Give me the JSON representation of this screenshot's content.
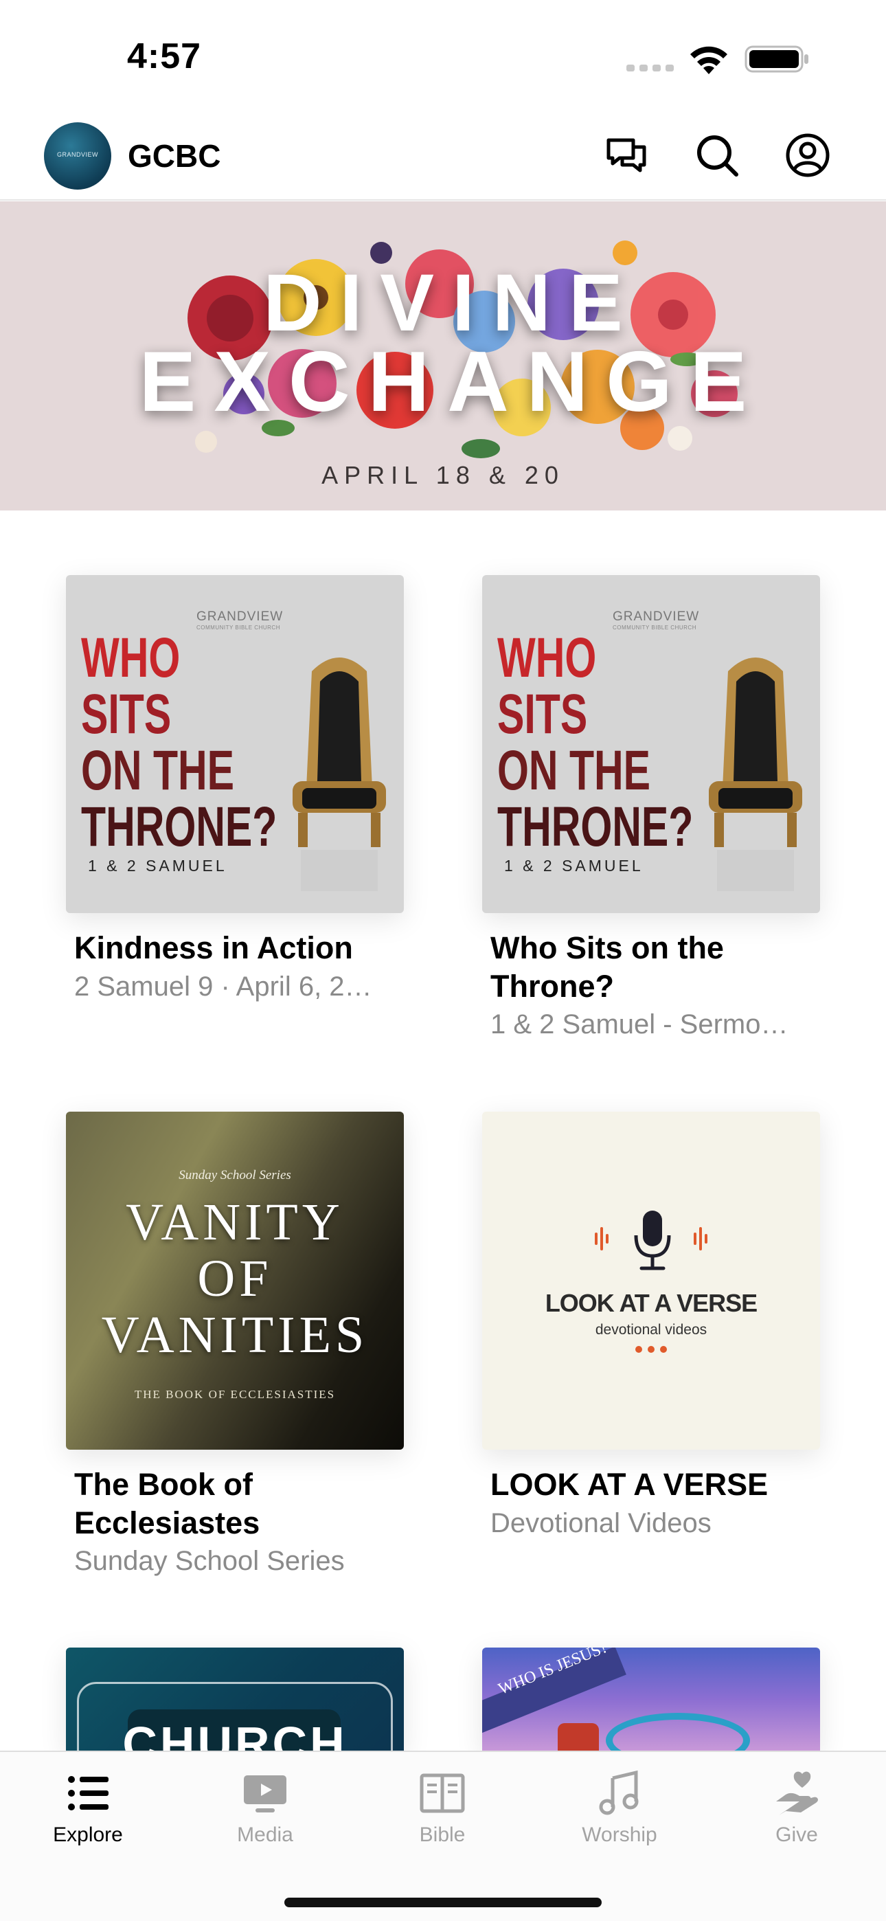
{
  "status_bar": {
    "time": "4:57"
  },
  "header": {
    "title": "GCBC",
    "avatar_text": "GRANDVIEW"
  },
  "banner": {
    "line1": "DIVINE",
    "line2": "EXCHANGE",
    "date": "APRIL 18 & 20"
  },
  "cards": [
    {
      "title": "Kindness in Action",
      "subtitle": "2 Samuel 9 · April 6, 2…",
      "art": {
        "brand": "GRANDVIEW",
        "brand_small": "COMMUNITY BIBLE CHURCH",
        "words": [
          "WHO",
          "SITS",
          "ON THE",
          "THRONE?"
        ],
        "series": "1 & 2 SAMUEL"
      }
    },
    {
      "title": "Who Sits on the Throne?",
      "subtitle": "1 & 2 Samuel - Sermo…",
      "art": {
        "brand": "GRANDVIEW",
        "brand_small": "COMMUNITY BIBLE CHURCH",
        "words": [
          "WHO",
          "SITS",
          "ON THE",
          "THRONE?"
        ],
        "series": "1 & 2 SAMUEL"
      }
    },
    {
      "title": "The Book of Ecclesiastes",
      "subtitle": "Sunday School Series",
      "art": {
        "kicker": "Sunday School Series",
        "lines": [
          "VANITY",
          "OF",
          "VANITIES"
        ],
        "sub": "THE BOOK OF ECCLESIASTIES"
      }
    },
    {
      "title": "LOOK AT A VERSE",
      "subtitle": "Devotional Videos",
      "art": {
        "title": "LOOK AT A VERSE",
        "sub": "devotional videos"
      }
    },
    {
      "art": {
        "text": "CHURCH"
      }
    },
    {
      "art": {
        "text": "WHO IS JESUS?"
      }
    }
  ],
  "tabs": [
    {
      "label": "Explore",
      "icon": "list-icon",
      "active": true
    },
    {
      "label": "Media",
      "icon": "tv-icon",
      "active": false
    },
    {
      "label": "Bible",
      "icon": "book-icon",
      "active": false
    },
    {
      "label": "Worship",
      "icon": "music-note-icon",
      "active": false
    },
    {
      "label": "Give",
      "icon": "hand-heart-icon",
      "active": false
    }
  ],
  "colors": {
    "tab_active": "#000000",
    "tab_inactive": "#a3a3a3",
    "banner_bg": "#e4d8d9",
    "throne_red": "#c7262a",
    "verse_accent": "#e05a2b"
  }
}
